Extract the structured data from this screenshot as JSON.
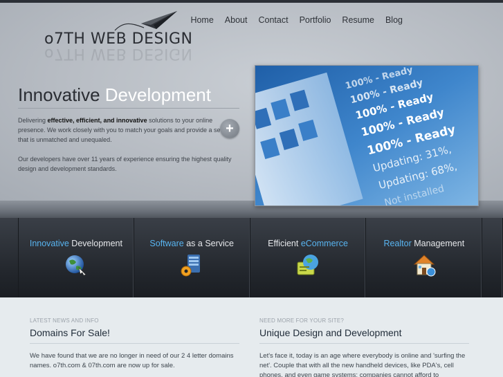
{
  "logo": {
    "text": "o7TH WEB DESIGN"
  },
  "nav": {
    "items": [
      "Home",
      "About",
      "Contact",
      "Portfolio",
      "Resume",
      "Blog"
    ]
  },
  "hero": {
    "headline_part1": "Innovative",
    "headline_part2": "Development",
    "para1_lead": "Delivering ",
    "para1_bold": "effective, efficient, and innovative",
    "para1_rest": " solutions to your online presence. We work closely with you to match your goals and provide a service that is unmatched and unequaled.",
    "para2": "Our developers have over 11 years of experience ensuring the highest quality design and development standards.",
    "plus_icon": "plus-icon",
    "image_lines": [
      "100% - Ready",
      "100% - Ready",
      "100% - Ready",
      "100% - Ready",
      "100% - Ready",
      "Updating: 31%,",
      "Updating: 68%,",
      "Not installed"
    ]
  },
  "services": [
    {
      "accent": "Innovative",
      "rest": " Development",
      "accent_first": true,
      "icon": "globe-icon"
    },
    {
      "accent": "Software",
      "rest": " as a Service",
      "accent_first": true,
      "icon": "gear-server-icon"
    },
    {
      "plain": "Efficient ",
      "accent": "eCommerce",
      "accent_first": false,
      "icon": "ecommerce-icon"
    },
    {
      "accent": "Realtor",
      "rest": " Management",
      "accent_first": true,
      "icon": "house-icon"
    }
  ],
  "news": {
    "kicker": "LATEST NEWS AND INFO",
    "title": "Domains For Sale!",
    "body": "We have found that we are no longer in need of our 2 4 letter domains names. o7th.com & 07th.com are now up for sale."
  },
  "more": {
    "kicker": "NEED MORE FOR YOUR SITE?",
    "title": "Unique Design and Development",
    "body": "Let's face it, today is an age where everybody is online and 'surfing the net'. Couple that with all the new handheld devices, like PDA's, cell phones, and even game systems; companies cannot afford to"
  },
  "colors": {
    "accent": "#58b4f0",
    "dark_band": "#22262c",
    "hero_bg": "#b7bcc3"
  }
}
